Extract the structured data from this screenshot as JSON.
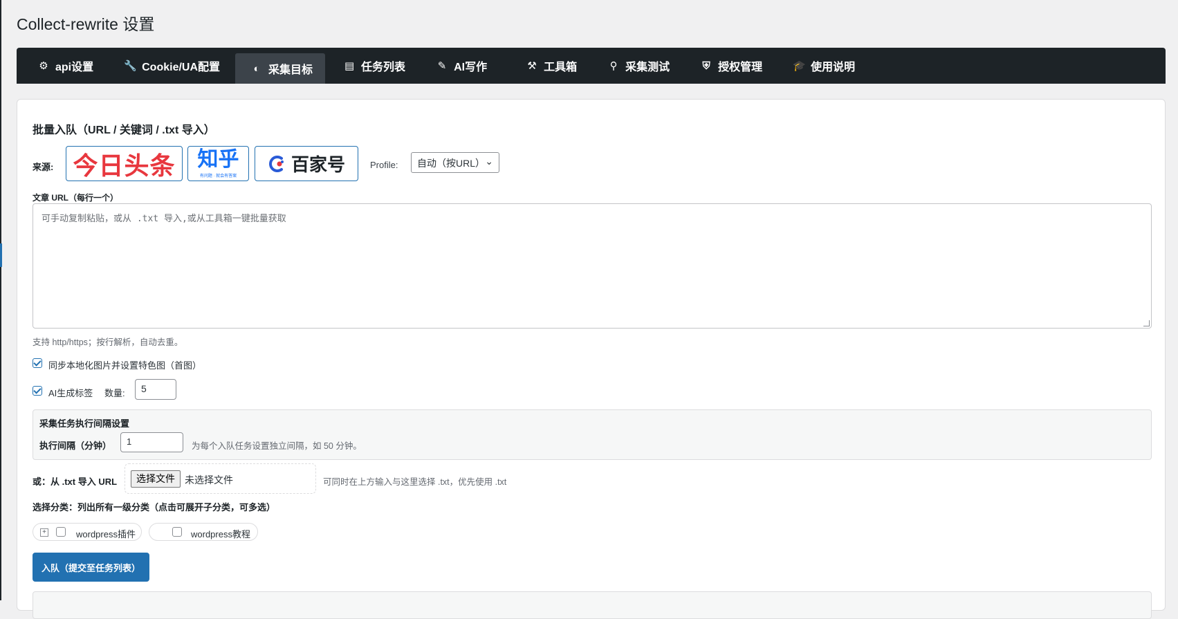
{
  "page": {
    "title": "Collect-rewrite 设置"
  },
  "tabs": [
    {
      "label": "api设置",
      "icon": "gear-icon",
      "glyph": "⚙"
    },
    {
      "label": "Cookie/UA配置",
      "icon": "wrench-icon",
      "glyph": "🔧"
    },
    {
      "label": "采集目标",
      "icon": "globe-icon",
      "glyph": "◐",
      "active": true
    },
    {
      "label": "任务列表",
      "icon": "list-icon",
      "glyph": "▤"
    },
    {
      "label": "AI写作",
      "icon": "pencil-icon",
      "glyph": "✎"
    },
    {
      "label": "工具箱",
      "icon": "hammer-icon",
      "glyph": "⚒"
    },
    {
      "label": "采集测试",
      "icon": "search-icon",
      "glyph": "⚲"
    },
    {
      "label": "授权管理",
      "icon": "shield-icon",
      "glyph": "⛨"
    },
    {
      "label": "使用说明",
      "icon": "graduation-cap-icon",
      "glyph": "🎓"
    }
  ],
  "batch": {
    "title": "批量入队（URL / 关键词 / .txt 导入）",
    "source_label": "来源:",
    "sources": {
      "toutiao": "今日头条",
      "zhihu": "知乎",
      "zhihu_sub": "有问题 · 就会有答案",
      "baijiahao": "百家号"
    },
    "profile_label": "Profile:",
    "profile_value": "自动（按URL）",
    "url_label": "文章 URL（每行一个）",
    "url_placeholder": "可手动复制粘贴，或从 .txt 导入,或从工具箱一键批量获取",
    "url_help": "支持 http/https；按行解析，自动去重。",
    "sync_images_label": "同步本地化图片并设置特色图（首图）",
    "ai_tags_label": "AI生成标签",
    "tag_count_label": "数量:",
    "tag_count_value": "5"
  },
  "interval": {
    "title": "采集任务执行间隔设置",
    "label": "执行间隔（分钟）",
    "value": "1",
    "help": "为每个入队任务设置独立间隔，如 50 分钟。"
  },
  "file_import": {
    "label": "或：从 .txt 导入 URL",
    "button": "选择文件",
    "none": "未选择文件",
    "help": "可同时在上方输入与这里选择 .txt，优先使用 .txt"
  },
  "category": {
    "title": "选择分类：列出所有一级分类（点击可展开子分类，可多选）",
    "items": [
      "wordpress插件",
      "wordpress教程"
    ]
  },
  "submit_label": "入队（提交至任务列表）",
  "colors": {
    "accent": "#2271b1",
    "tabbar": "#1d2327",
    "tab_active": "#3c434a",
    "toutiao_red": "#e8373e",
    "zhihu_blue": "#1772f6"
  }
}
